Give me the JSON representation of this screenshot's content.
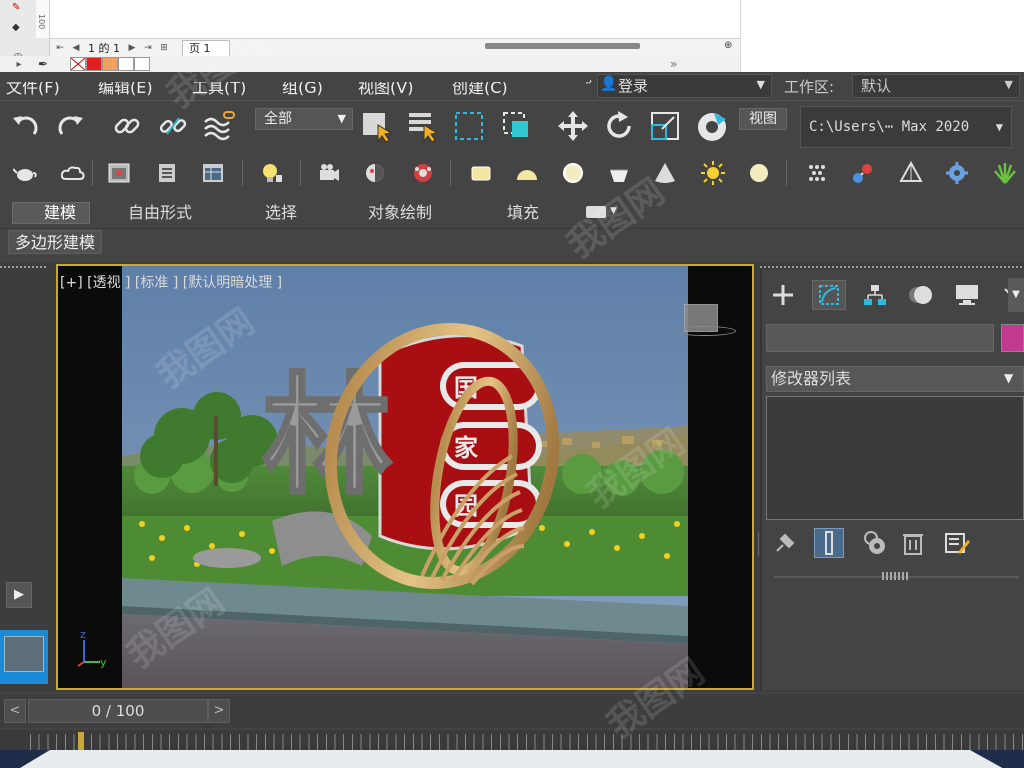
{
  "top_window": {
    "page_counter": "1 的 1",
    "page_tab": "页 1",
    "ruler_mark": "100"
  },
  "menu": {
    "items": [
      "文件(F)",
      "编辑(E)",
      "工具(T)",
      "组(G)",
      "视图(V)",
      "创建(C)"
    ],
    "login": "登录",
    "workspace_label": "工作区:",
    "workspace_value": "默认"
  },
  "toolbar": {
    "filter": "全部",
    "view": "视图",
    "path": "C:\\Users\\⋯ Max 2020"
  },
  "ribbon": {
    "tabs": [
      "建模",
      "自由形式",
      "选择",
      "对象绘制",
      "填充"
    ],
    "panel_label": "多边形建模"
  },
  "viewport": {
    "label": "[+] [透视 ] [标准 ] [默认明暗处理 ]",
    "scene_text": "林",
    "board_chars": [
      "国",
      "家",
      "园"
    ]
  },
  "command_panel": {
    "modifier_list": "修改器列表",
    "object_color": "#c23a8f"
  },
  "time": {
    "slider": "0 / 100"
  },
  "watermark": "我图网",
  "colors": {
    "accent": "#c9a83a",
    "swatches": [
      "#ffffff",
      "#e02020",
      "#f0a060",
      "#ffffff",
      "#ffffff"
    ]
  }
}
